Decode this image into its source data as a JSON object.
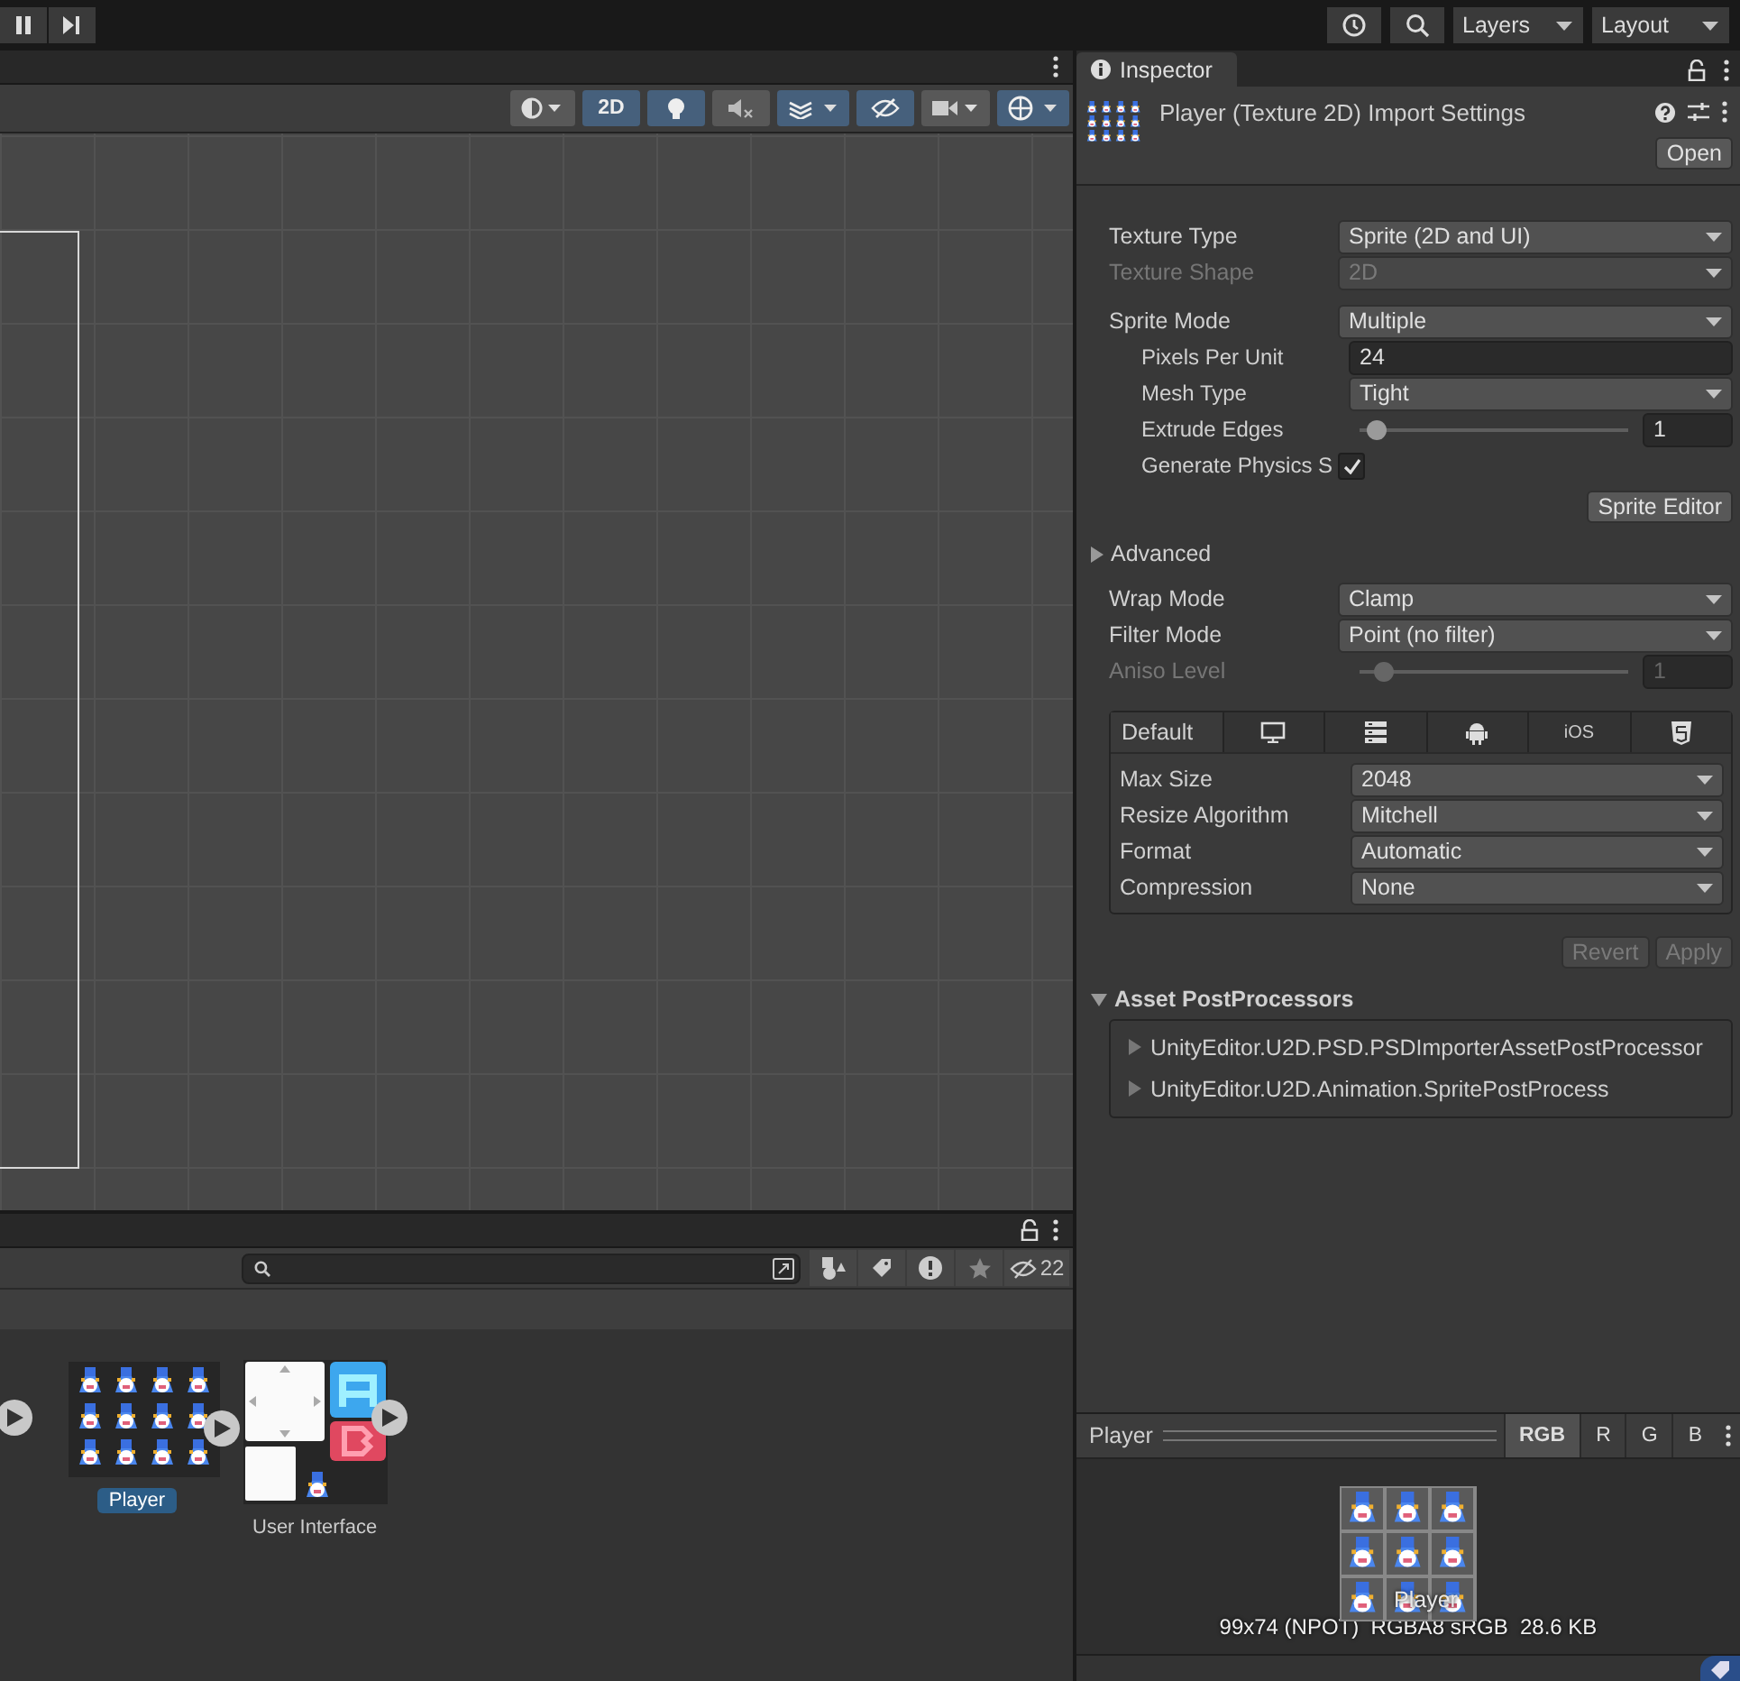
{
  "toolbar": {
    "layers": "Layers",
    "layout": "Layout"
  },
  "scene_toolbar": [
    {
      "kind": "shading",
      "selected": false
    },
    {
      "kind": "dimension",
      "label": "2D",
      "selected": true
    },
    {
      "kind": "light",
      "selected": true
    },
    {
      "kind": "audio",
      "selected": false
    },
    {
      "kind": "effects",
      "selected": true
    },
    {
      "kind": "visibility",
      "selected": true
    },
    {
      "kind": "camera",
      "selected": false
    },
    {
      "kind": "gizmos",
      "selected": true
    }
  ],
  "project": {
    "hidden_count": "22",
    "assets": [
      {
        "kind": "sprite-sheet",
        "name": "Player",
        "selected": true
      },
      {
        "kind": "ui-sheet",
        "name": "User Interface",
        "selected": false
      }
    ]
  },
  "inspector": {
    "tab": "Inspector",
    "title": "Player (Texture 2D) Import Settings",
    "open_button": "Open",
    "fields": [
      {
        "kind": "dropdown",
        "label": "Texture Type",
        "value": "Sprite (2D and UI)",
        "disabled": false
      },
      {
        "kind": "dropdown",
        "label": "Texture Shape",
        "value": "2D",
        "disabled": true
      },
      {
        "kind": "dropdown",
        "label": "Sprite Mode",
        "value": "Multiple",
        "disabled": false,
        "children": [
          {
            "kind": "number",
            "label": "Pixels Per Unit",
            "value": "24",
            "disabled": false
          },
          {
            "kind": "dropdown",
            "label": "Mesh Type",
            "value": "Tight",
            "disabled": false
          },
          {
            "kind": "slider",
            "label": "Extrude Edges",
            "value": "1",
            "level": 0.03,
            "disabled": false
          },
          {
            "kind": "checkbox",
            "label": "Generate Physics S",
            "checked": true,
            "disabled": false
          }
        ]
      }
    ],
    "sprite_editor_button": "Sprite Editor",
    "advanced": {
      "label": "Advanced",
      "expanded": false
    },
    "fields_2": [
      {
        "kind": "dropdown",
        "label": "Wrap Mode",
        "value": "Clamp",
        "disabled": false
      },
      {
        "kind": "dropdown",
        "label": "Filter Mode",
        "value": "Point (no filter)",
        "disabled": false
      },
      {
        "kind": "slider",
        "label": "Aniso Level",
        "value": "1",
        "level": 0.06,
        "disabled": true
      }
    ],
    "platform_tabs": [
      {
        "kind": "text",
        "label": "Default",
        "selected": true
      },
      {
        "kind": "monitor",
        "selected": false
      },
      {
        "kind": "server",
        "selected": false
      },
      {
        "kind": "robot",
        "selected": false
      },
      {
        "kind": "text",
        "label": "iOS",
        "selected": false
      },
      {
        "kind": "shield",
        "selected": false
      }
    ],
    "platform_fields": [
      {
        "kind": "dropdown",
        "label": "Max Size",
        "value": "2048",
        "disabled": false
      },
      {
        "kind": "dropdown",
        "label": "Resize Algorithm",
        "value": "Mitchell",
        "disabled": false
      },
      {
        "kind": "dropdown",
        "label": "Format",
        "value": "Automatic",
        "disabled": false
      },
      {
        "kind": "dropdown",
        "label": "Compression",
        "value": "None",
        "disabled": false
      }
    ],
    "buttons": [
      {
        "label": "Revert",
        "disabled": true
      },
      {
        "label": "Apply",
        "disabled": true
      }
    ],
    "postprocessors": {
      "title": "Asset PostProcessors",
      "expanded": true,
      "items": [
        {
          "label": "UnityEditor.U2D.PSD.PSDImporterAssetPostProcessor",
          "expanded": false
        },
        {
          "label": "UnityEditor.U2D.Animation.SpritePostProcess",
          "expanded": false
        }
      ]
    }
  },
  "preview": {
    "title": "Player",
    "channels": [
      {
        "label": "RGB",
        "selected": true
      },
      {
        "label": "R",
        "selected": false
      },
      {
        "label": "G",
        "selected": false
      },
      {
        "label": "B",
        "selected": false
      }
    ],
    "caption": "Player",
    "info": "99x74 (NPOT)  RGBA8 sRGB  28.6 KB"
  }
}
